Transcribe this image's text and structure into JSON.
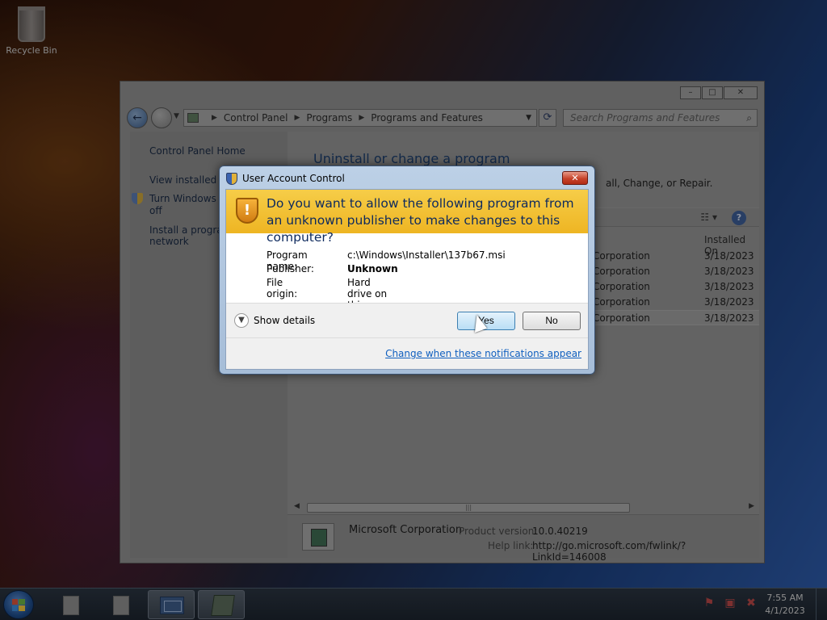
{
  "desktop": {
    "recycle_bin_label": "Recycle Bin"
  },
  "explorer": {
    "address_parts": [
      "Control Panel",
      "Programs",
      "Programs and Features"
    ],
    "search_placeholder": "Search Programs and Features",
    "left_links": [
      "Control Panel Home",
      "View installed up",
      "Turn Windows fe",
      "off",
      "Install a program",
      "network"
    ],
    "title": "Uninstall or change a program",
    "description": "all, Change, or Repair.",
    "column_installed_on": "Installed On",
    "rows": [
      {
        "publisher": "Corporation",
        "date": "3/18/2023"
      },
      {
        "publisher": "Corporation",
        "date": "3/18/2023"
      },
      {
        "publisher": "Corporation",
        "date": "3/18/2023"
      },
      {
        "publisher": "Corporation",
        "date": "3/18/2023"
      },
      {
        "publisher": "Corporation",
        "date": "3/18/2023"
      }
    ],
    "details": {
      "company": "Microsoft Corporation",
      "product_version_label": "Product version:",
      "product_version": "10.0.40219",
      "help_link_label": "Help link:",
      "help_link": "http://go.microsoft.com/fwlink/?LinkId=146008"
    }
  },
  "uac": {
    "title": "User Account Control",
    "question": "Do you want to allow the following program from an unknown publisher to make changes to this computer?",
    "program_name_label": "Program name:",
    "program_name": "c:\\Windows\\Installer\\137b67.msi",
    "publisher_label": "Publisher:",
    "publisher": "Unknown",
    "file_origin_label": "File origin:",
    "file_origin": "Hard drive on this computer",
    "show_details": "Show details",
    "yes_label": "Yes",
    "no_label": "No",
    "change_link": "Change when these notifications appear"
  },
  "taskbar": {
    "time": "7:55 AM",
    "date": "4/1/2023"
  },
  "colors": {
    "uac_banner": "#f6cd48",
    "link_blue": "#0f5fbf",
    "title_blue": "#1d3f6e"
  }
}
